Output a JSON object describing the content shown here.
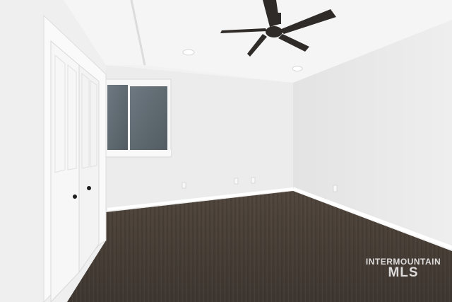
{
  "scene": "empty bedroom with ceiling fan, window, closet with bifold doors and dark carpet",
  "watermark": {
    "line1": "INTERMOUNTAIN",
    "line2": "MLS"
  },
  "colors": {
    "ceiling": "#f4f4f4",
    "left_wall": "#efefef",
    "back_wall": "#ececec",
    "right_wall": "#e9e9e9",
    "carpet": "#4a4139",
    "window_glass": "#5f6a70",
    "fan": "#2f2b29"
  }
}
